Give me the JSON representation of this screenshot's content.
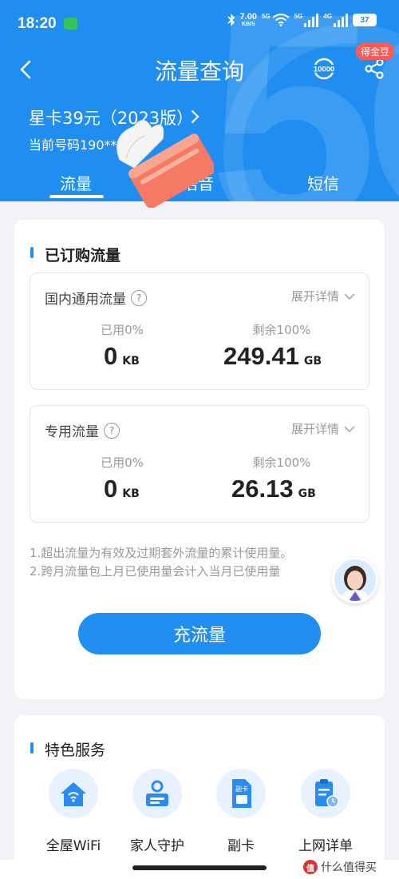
{
  "status_bar": {
    "time": "18:20",
    "speed_value": "7.00",
    "speed_unit": "KB/S",
    "net_5g": "5G",
    "net_4g": "4G",
    "battery": "37"
  },
  "nav": {
    "title": "流量查询",
    "hotline": "10000",
    "coin_badge": "得金豆"
  },
  "plan": {
    "name": "星卡39元（2023版）",
    "phone_line": "当前号码190**"
  },
  "tabs": {
    "items": [
      {
        "label": "流量"
      },
      {
        "label": "语音"
      },
      {
        "label": "短信"
      }
    ],
    "active_index": 0
  },
  "purchased": {
    "title": "已订购流量",
    "boxes": [
      {
        "label": "国内通用流量",
        "expand": "展开详情",
        "used_label": "已用0%",
        "used_value": "0",
        "used_unit": "KB",
        "remain_label": "剩余100%",
        "remain_value": "249.41",
        "remain_unit": "GB"
      },
      {
        "label": "专用流量",
        "expand": "展开详情",
        "used_label": "已用0%",
        "used_value": "0",
        "used_unit": "KB",
        "remain_label": "剩余100%",
        "remain_value": "26.13",
        "remain_unit": "GB"
      }
    ],
    "notes": [
      "1.超出流量为有效及过期套外流量的累计使用量。",
      "2.跨月流量包上月已使用量会计入当月已使用量"
    ],
    "recharge_button": "充流量"
  },
  "services": {
    "title": "特色服务",
    "items": [
      {
        "label": "全屋WiFi",
        "icon": "house-wifi-icon"
      },
      {
        "label": "家人守护",
        "icon": "family-guard-icon"
      },
      {
        "label": "副卡",
        "icon": "sim-card-icon"
      },
      {
        "label": "上网详单",
        "icon": "usage-list-icon"
      }
    ]
  },
  "watermark": {
    "logo": "值",
    "text": "什么值得买"
  },
  "colors": {
    "brand_blue": "#1f8ef0",
    "badge_red": "#ff5a5a",
    "background": "#f2f3f7"
  }
}
